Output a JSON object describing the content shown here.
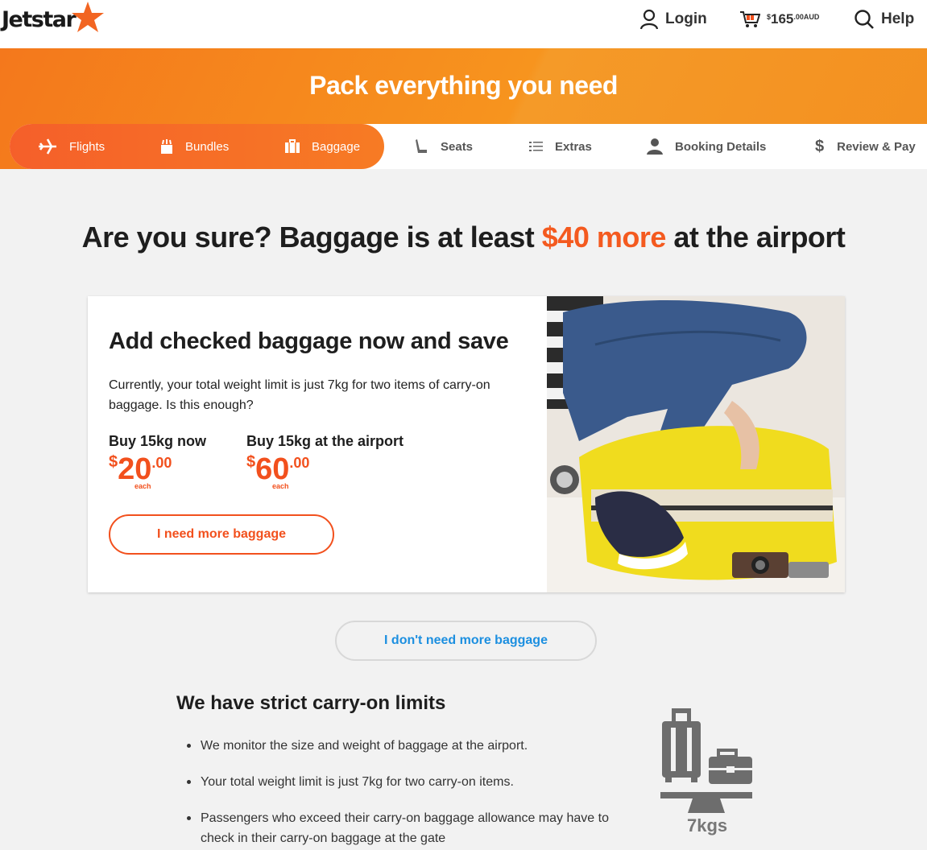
{
  "header": {
    "brand": "Jetstar",
    "login_label": "Login",
    "cart": {
      "currency_symbol": "$",
      "amount": "165",
      "cents_currency": ".00AUD"
    },
    "help_label": "Help"
  },
  "banner": {
    "title": "Pack everything you need"
  },
  "steps": [
    {
      "label": "Flights",
      "icon": "plane-icon",
      "active": true
    },
    {
      "label": "Bundles",
      "icon": "bundle-icon",
      "active": true
    },
    {
      "label": "Baggage",
      "icon": "suitcase-icon",
      "active": true
    },
    {
      "label": "Seats",
      "icon": "seat-icon",
      "active": false
    },
    {
      "label": "Extras",
      "icon": "list-icon",
      "active": false
    },
    {
      "label": "Booking Details",
      "icon": "person-icon",
      "active": false
    },
    {
      "label": "Review & Pay",
      "icon": "dollar-icon",
      "active": false
    }
  ],
  "heading": {
    "part1": "Are you sure? Baggage is at least ",
    "accent": "$40 more",
    "part2": " at the airport"
  },
  "offer": {
    "title": "Add checked baggage now and save",
    "text": "Currently, your total weight limit is just 7kg for two items of carry-on baggage. Is this enough?",
    "now": {
      "label": "Buy 15kg now",
      "currency": "$",
      "amount": "20",
      "cents": ".00",
      "unit": "each"
    },
    "airport": {
      "label": "Buy 15kg at the airport",
      "currency": "$",
      "amount": "60",
      "cents": ".00",
      "unit": "each"
    },
    "button_label": "I need more baggage"
  },
  "decline_label": "I don't need more baggage",
  "limits": {
    "title": "We have strict carry-on limits",
    "items": [
      "We monitor the size and weight of baggage at the airport.",
      "Your total weight limit is just 7kg for two carry-on items.",
      "Passengers who exceed their carry-on baggage allowance may have to check in their carry-on baggage at the gate"
    ],
    "weight_label": "7kgs"
  },
  "colors": {
    "brand_orange": "#f4781c",
    "accent_red": "#f2501d",
    "link_blue": "#1c8fe0"
  }
}
